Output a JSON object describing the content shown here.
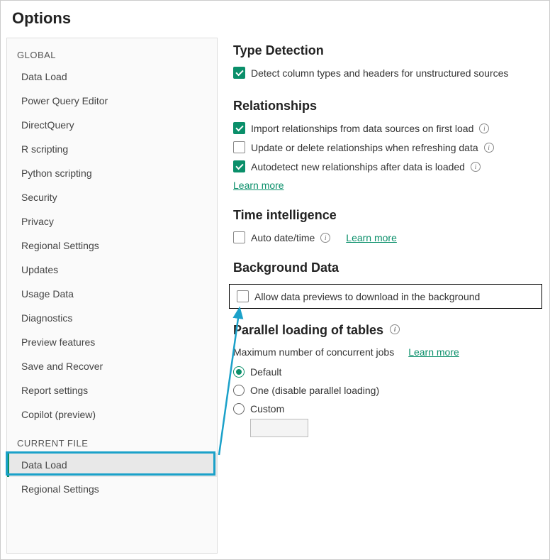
{
  "title": "Options",
  "sidebar": {
    "groups": [
      {
        "header": "GLOBAL",
        "items": [
          "Data Load",
          "Power Query Editor",
          "DirectQuery",
          "R scripting",
          "Python scripting",
          "Security",
          "Privacy",
          "Regional Settings",
          "Updates",
          "Usage Data",
          "Diagnostics",
          "Preview features",
          "Save and Recover",
          "Report settings",
          "Copilot (preview)"
        ]
      },
      {
        "header": "CURRENT FILE",
        "items": [
          "Data Load",
          "Regional Settings"
        ],
        "selected_index": 0
      }
    ]
  },
  "sections": {
    "type_detection": {
      "title": "Type Detection",
      "opt1": {
        "checked": true,
        "label": "Detect column types and headers for unstructured sources"
      }
    },
    "relationships": {
      "title": "Relationships",
      "opt1": {
        "checked": true,
        "label": "Import relationships from data sources on first load"
      },
      "opt2": {
        "checked": false,
        "label": "Update or delete relationships when refreshing data"
      },
      "opt3": {
        "checked": true,
        "label": "Autodetect new relationships after data is loaded"
      },
      "learn_more": "Learn more"
    },
    "time_intelligence": {
      "title": "Time intelligence",
      "opt1": {
        "checked": false,
        "label": "Auto date/time"
      },
      "learn_more": "Learn more"
    },
    "background_data": {
      "title": "Background Data",
      "opt1": {
        "checked": false,
        "label": "Allow data previews to download in the background"
      }
    },
    "parallel": {
      "title": "Parallel loading of tables",
      "field_label": "Maximum number of concurrent jobs",
      "learn_more": "Learn more",
      "radios": {
        "default": "Default",
        "one": "One (disable parallel loading)",
        "custom": "Custom"
      },
      "selected": "default"
    }
  }
}
